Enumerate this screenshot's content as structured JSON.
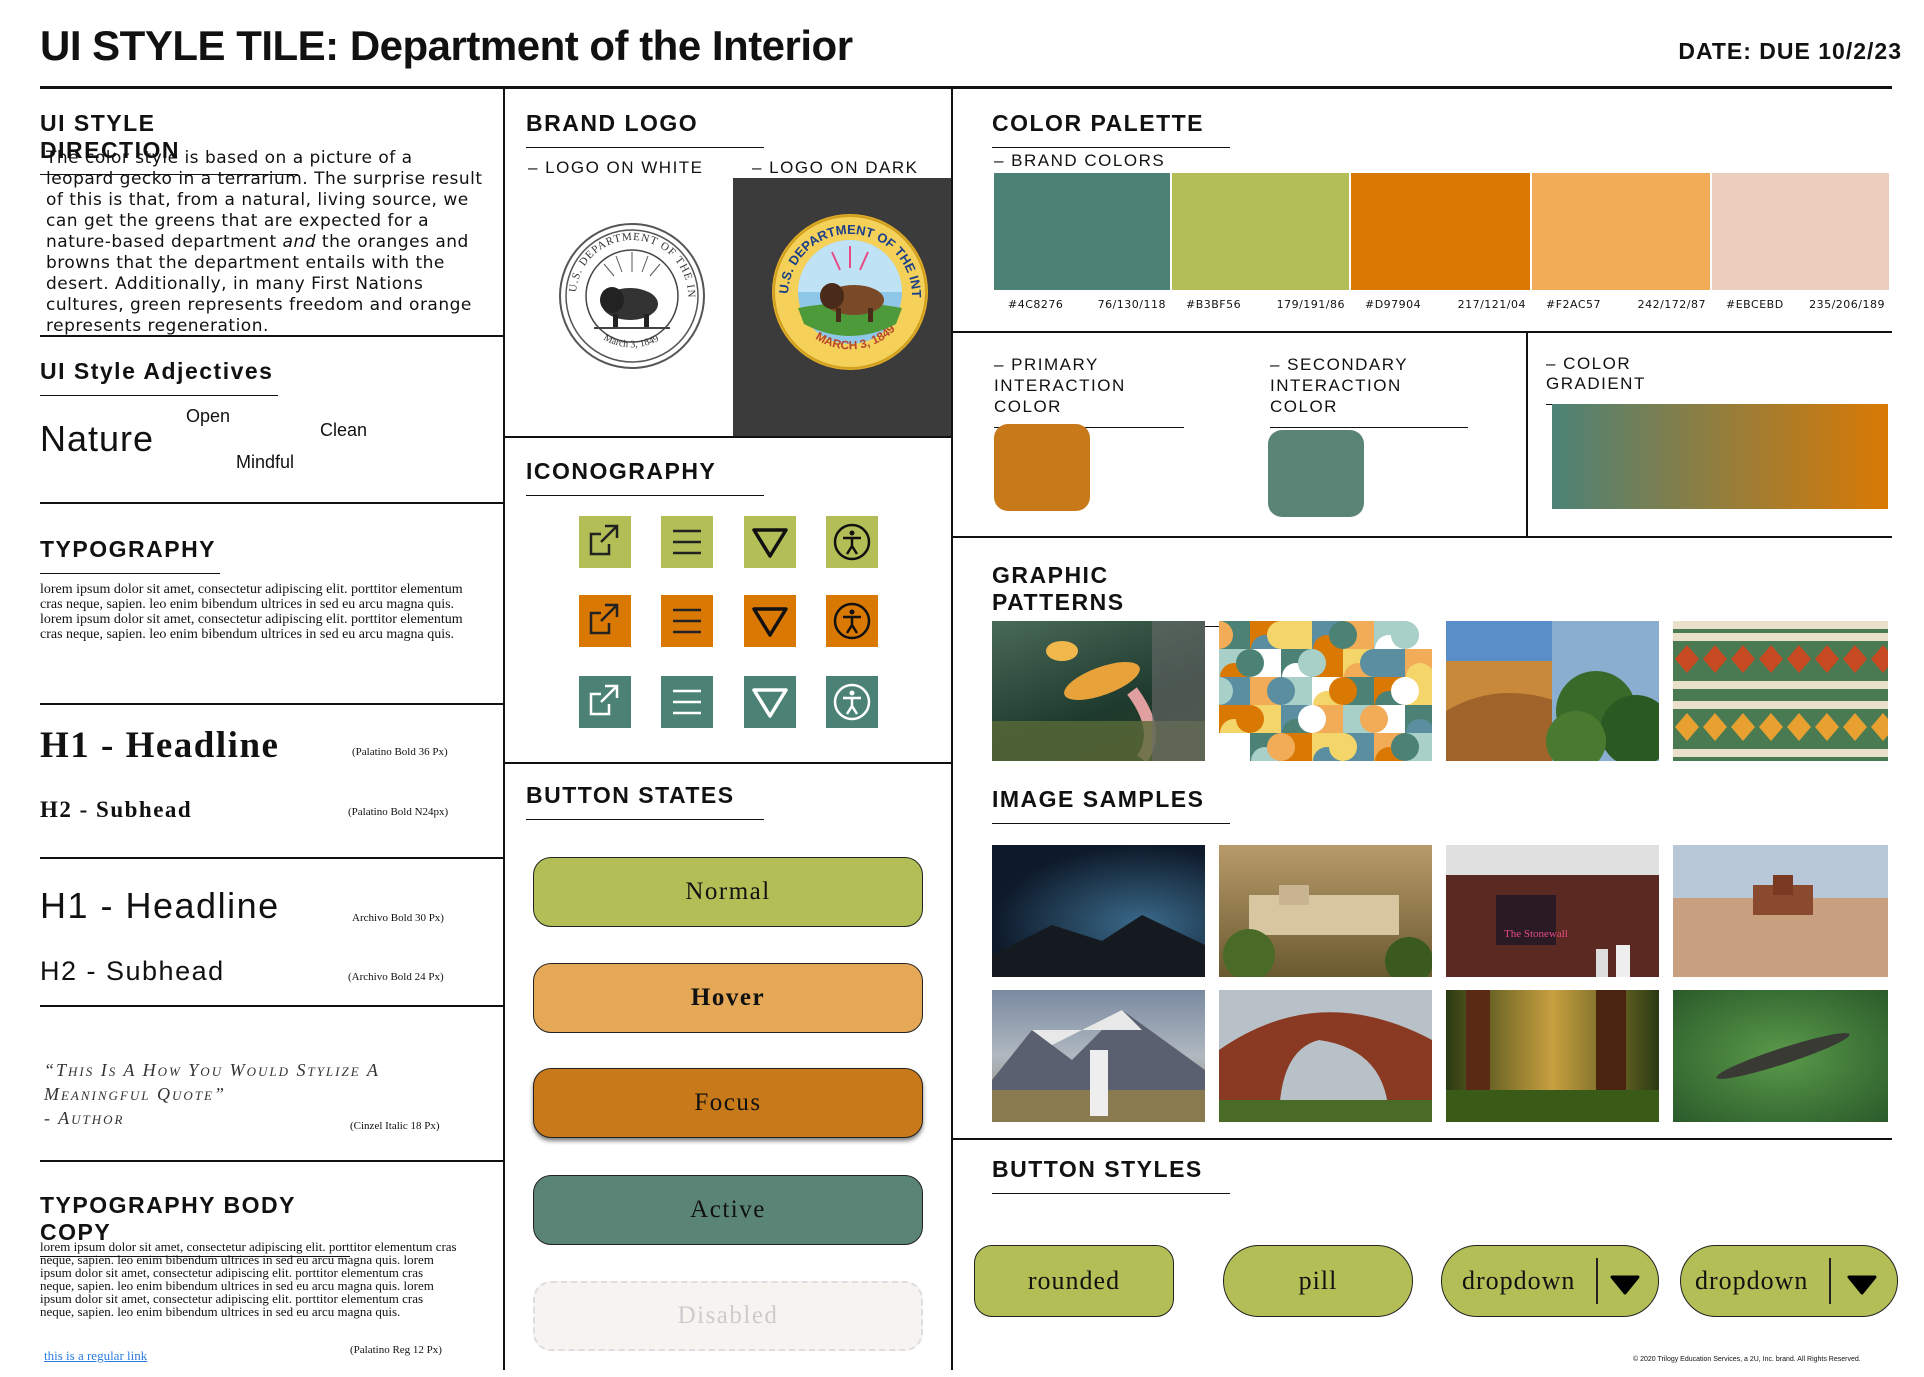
{
  "header": {
    "title": "UI STYLE TILE: Department of the Interior",
    "date": "DATE: DUE 10/2/23"
  },
  "style_direction": {
    "heading": "UI STYLE DIRECTION",
    "text_1": "The color style is based on a picture of a leopard gecko in a terrarium. The surprise result of this is that, from a natural, living source, we can get the greens that are expected for a nature-based department ",
    "text_em": "and",
    "text_2": " the oranges and browns that the department entails with the desert. Additionally, in many First Nations cultures, green represents freedom and orange represents regeneration."
  },
  "adjectives": {
    "heading": "UI Style Adjectives",
    "nature": "Nature",
    "open": "Open",
    "clean": "Clean",
    "mindful": "Mindful"
  },
  "typography": {
    "heading": "TYPOGRAPHY",
    "sample": "lorem ipsum dolor sit amet, consectetur adipiscing elit. porttitor elementum cras neque, sapien. leo enim bibendum ultrices in sed eu arcu magna quis. lorem ipsum dolor sit amet, consectetur adipiscing elit. porttitor elementum cras neque, sapien. leo enim bibendum ultrices in sed eu arcu magna quis.",
    "h1_serif": "H1 - Headline",
    "h1_serif_note": "(Palatino Bold 36 Px)",
    "h2_serif": "H2 - Subhead",
    "h2_serif_note": "(Palatino Bold N24px)",
    "h1_sans": "H1 - Headline",
    "h1_sans_note": "Archivo Bold 30 Px)",
    "h2_sans": "H2 - Subhead",
    "h2_sans_note": "(Archivo Bold 24 Px)",
    "quote_1": "“This Is A How You Would Stylize A",
    "quote_2": "Meaningful Quote”",
    "quote_author": " - Author",
    "quote_note": "(Cinzel Italic 18 Px)"
  },
  "body_copy": {
    "heading": "TYPOGRAPHY BODY COPY",
    "text": "lorem ipsum dolor sit amet, consectetur adipiscing elit. porttitor elementum cras neque, sapien. leo enim bibendum ultrices in sed eu arcu magna quis. lorem ipsum dolor sit amet, consectetur adipiscing elit. porttitor elementum cras neque, sapien. leo enim bibendum ultrices in sed eu arcu magna quis. lorem ipsum dolor sit amet, consectetur adipiscing elit. porttitor elementum cras neque, sapien. leo enim bibendum ultrices in sed eu arcu magna quis.",
    "link": "this is a regular link",
    "note": "(Palatino Reg 12 Px)"
  },
  "brand_logo": {
    "heading": "BRAND LOGO",
    "on_white": "– LOGO ON WHITE",
    "on_dark": "– LOGO ON DARK",
    "seal_top": "U.S. DEPARTMENT OF THE INTERIOR",
    "seal_date": "March 3, 1849",
    "seal_date_caps": "MARCH 3, 1849"
  },
  "iconography": {
    "heading": "ICONOGRAPHY",
    "colors": [
      "#B3BF56",
      "#D97904",
      "#4C8276"
    ]
  },
  "button_states": {
    "heading": "BUTTON STATES",
    "normal": "Normal",
    "hover": "Hover",
    "focus": "Focus",
    "active": "Active",
    "disabled": "Disabled"
  },
  "palette": {
    "heading": "COLOR PALETTE",
    "brand_label": "– BRAND COLORS",
    "colors": [
      {
        "hex": "#4C8276",
        "rgb": "76/130/118"
      },
      {
        "hex": "#B3BF56",
        "rgb": "179/191/86"
      },
      {
        "hex": "#D97904",
        "rgb": "217/121/04"
      },
      {
        "hex": "#F2AC57",
        "rgb": "242/172/87"
      },
      {
        "hex": "#EBCEBD",
        "rgb": "235/206/189"
      }
    ],
    "primary_label_1": "– PRIMARY",
    "primary_label_2": "INTERACTION COLOR",
    "secondary_label_1": "– SECONDARY",
    "secondary_label_2": "INTERACTION COLOR",
    "gradient_label": "– COLOR GRADIENT"
  },
  "patterns": {
    "heading": "GRAPHIC PATTERNS"
  },
  "samples": {
    "heading": "IMAGE SAMPLES",
    "stonewall": "The Stonewall"
  },
  "button_styles": {
    "heading": "BUTTON STYLES",
    "rounded": "rounded",
    "pill": "pill",
    "dropdown_1": "dropdown",
    "dropdown_2": "dropdown"
  },
  "footer": {
    "copyright": "© 2020 Trilogy Education Services, a 2U, Inc. brand. All Rights Reserved."
  }
}
